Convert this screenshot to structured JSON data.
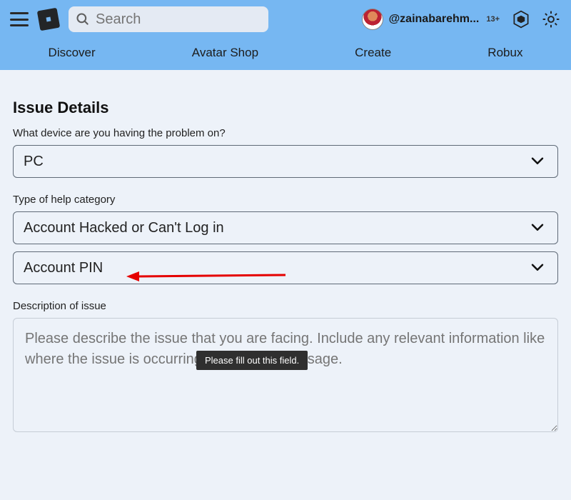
{
  "header": {
    "search_placeholder": "Search",
    "username": "@zainabarehm...",
    "age_label": "13+"
  },
  "nav": {
    "items": [
      "Discover",
      "Avatar Shop",
      "Create",
      "Robux"
    ]
  },
  "form": {
    "section_title": "Issue Details",
    "device_label": "What device are you having the problem on?",
    "device_value": "PC",
    "category_label": "Type of help category",
    "category_value": "Account Hacked or Can't Log in",
    "subcategory_value": "Account PIN",
    "description_label": "Description of issue",
    "description_placeholder": "Please describe the issue that you are facing. Include any relevant information like where the issue is occurring or the error message."
  },
  "tooltip": {
    "text": "Please fill out this field."
  }
}
